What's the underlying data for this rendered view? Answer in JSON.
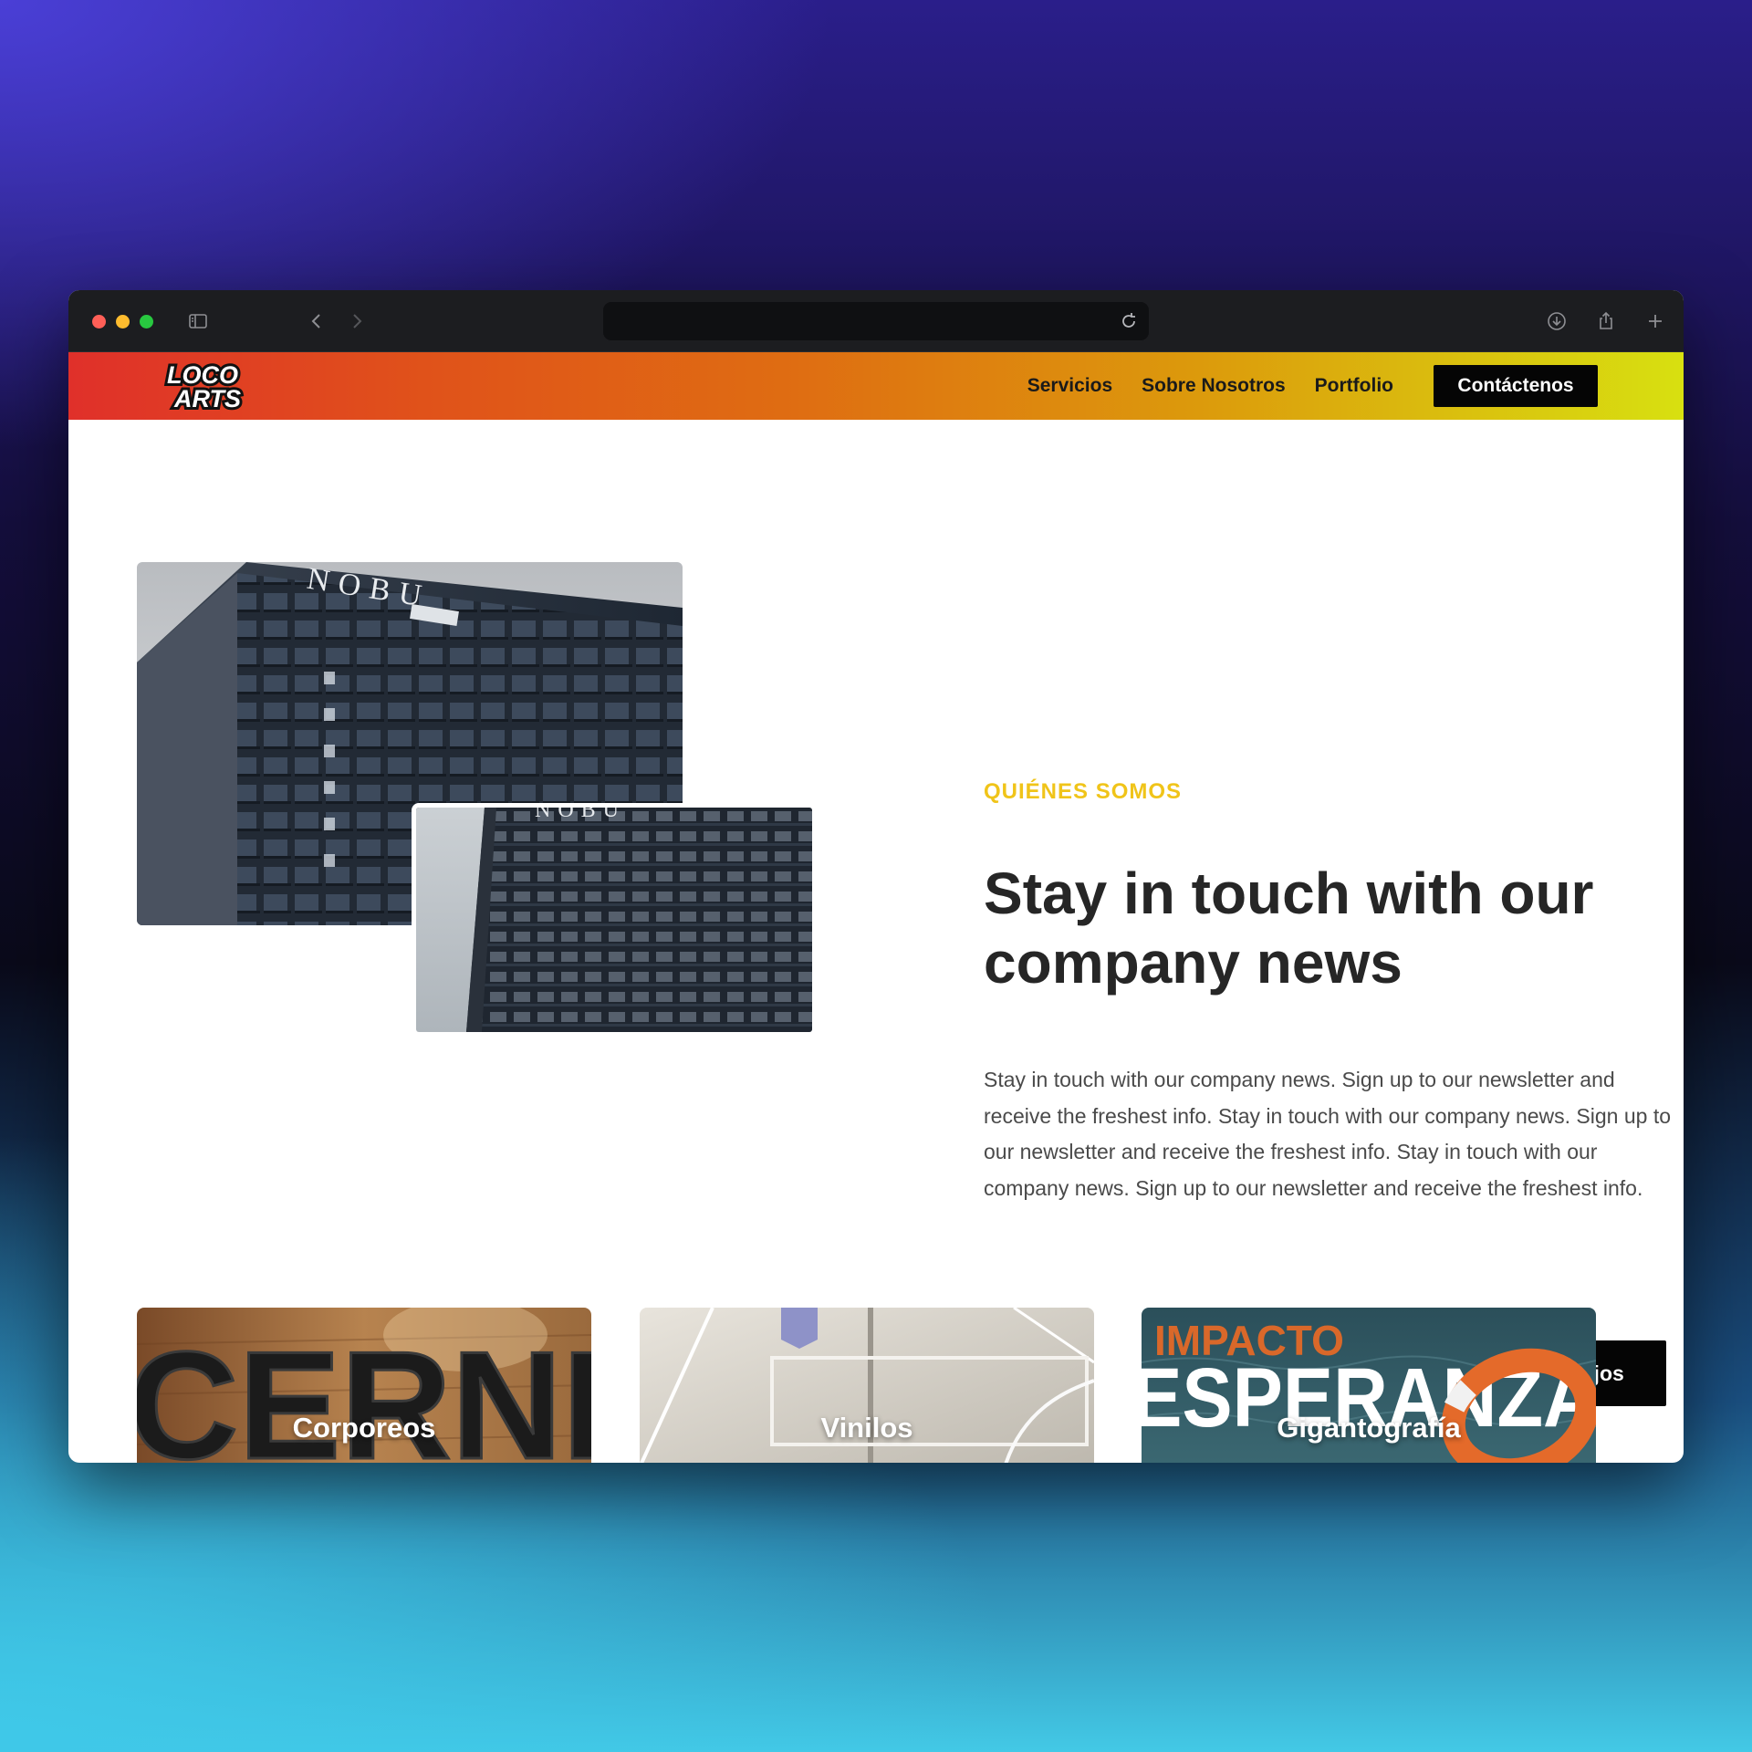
{
  "nav": {
    "logo_text": "LOCO ARTS",
    "links": [
      "Servicios",
      "Sobre Nosotros",
      "Portfolio"
    ],
    "cta_label": "Contáctenos"
  },
  "about": {
    "eyebrow": "QUIÉNES SOMOS",
    "headline": "Stay in touch with our company news",
    "body": "Stay in touch with our company news. Sign up to our newsletter and receive the freshest info. Stay in touch with our company news. Sign up to our newsletter and receive the freshest info. Stay in touch with our company news. Sign up to our newsletter and receive the freshest info.",
    "button_label": "Trabajos"
  },
  "photos": {
    "building_sign": "NOBU"
  },
  "services": [
    {
      "label": "Corporeos",
      "image_text": "CERNE"
    },
    {
      "label": "Vinilos"
    },
    {
      "label": "Gigantografía",
      "image_text_top": "IMPACTO",
      "image_text_main": "ESPERANZA"
    }
  ],
  "colors": {
    "accent_yellow": "#f0c419",
    "nav_gradient_start": "#e0302a",
    "nav_gradient_end": "#d8e010",
    "button_black": "#050505"
  }
}
